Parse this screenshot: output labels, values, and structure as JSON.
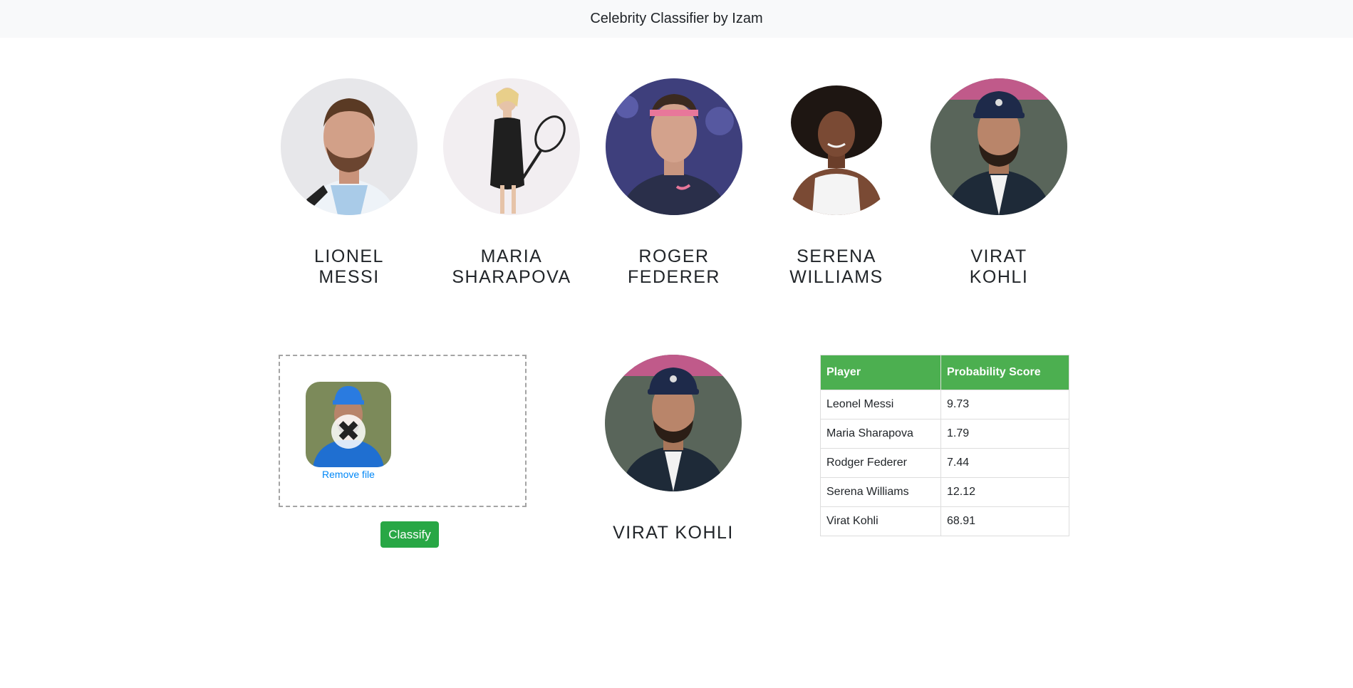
{
  "navbar": {
    "title": "Celebrity Classifier by Izam"
  },
  "celebrities": [
    {
      "first": "LIONEL",
      "last": "MESSI"
    },
    {
      "first": "MARIA",
      "last": "SHARAPOVA"
    },
    {
      "first": "ROGER",
      "last": "FEDERER"
    },
    {
      "first": "SERENA",
      "last": "WILLIAMS"
    },
    {
      "first": "VIRAT",
      "last": "KOHLI"
    }
  ],
  "upload": {
    "remove_icon": "close-icon",
    "remove_label": "Remove file"
  },
  "classify_label": "Classify",
  "result": {
    "name": "VIRAT KOHLI"
  },
  "table": {
    "headers": [
      "Player",
      "Probability Score"
    ],
    "rows": [
      [
        "Leonel Messi",
        "9.73"
      ],
      [
        "Maria Sharapova",
        "1.79"
      ],
      [
        "Rodger Federer",
        "7.44"
      ],
      [
        "Serena Williams",
        "12.12"
      ],
      [
        "Virat Kohli",
        "68.91"
      ]
    ]
  },
  "colors": {
    "accent": "#28a745",
    "table_header": "#4caf50",
    "link": "#0087f7",
    "navbar_bg": "#f8f9fa"
  }
}
